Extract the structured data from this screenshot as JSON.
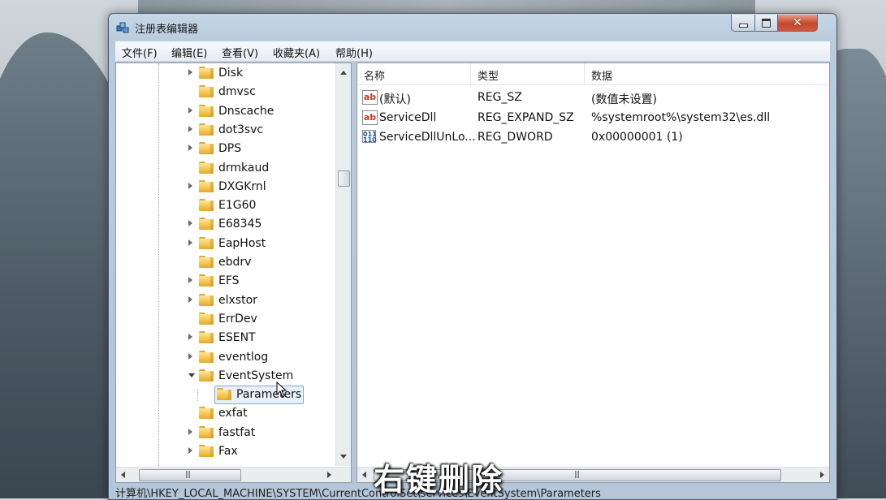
{
  "window": {
    "title": "注册表编辑器"
  },
  "menu": [
    "文件(F)",
    "编辑(E)",
    "查看(V)",
    "收藏夹(A)",
    "帮助(H)"
  ],
  "tree": {
    "items": [
      {
        "label": "Disk",
        "expandable": true
      },
      {
        "label": "dmvsc",
        "expandable": false
      },
      {
        "label": "Dnscache",
        "expandable": true
      },
      {
        "label": "dot3svc",
        "expandable": true
      },
      {
        "label": "DPS",
        "expandable": true
      },
      {
        "label": "drmkaud",
        "expandable": false
      },
      {
        "label": "DXGKrnl",
        "expandable": true
      },
      {
        "label": "E1G60",
        "expandable": false
      },
      {
        "label": "E68345",
        "expandable": true
      },
      {
        "label": "EapHost",
        "expandable": true
      },
      {
        "label": "ebdrv",
        "expandable": false
      },
      {
        "label": "EFS",
        "expandable": true
      },
      {
        "label": "elxstor",
        "expandable": true
      },
      {
        "label": "ErrDev",
        "expandable": false
      },
      {
        "label": "ESENT",
        "expandable": true
      },
      {
        "label": "eventlog",
        "expandable": true
      },
      {
        "label": "EventSystem",
        "expandable": true,
        "expanded": true
      },
      {
        "label": "Parameters",
        "expandable": false,
        "child": true,
        "selected": true
      },
      {
        "label": "exfat",
        "expandable": false
      },
      {
        "label": "fastfat",
        "expandable": true
      },
      {
        "label": "Fax",
        "expandable": true
      }
    ]
  },
  "list": {
    "columns": [
      "名称",
      "类型",
      "数据"
    ],
    "rows": [
      {
        "icon": "string-value-icon",
        "name": "(默认)",
        "type": "REG_SZ",
        "data": "(数值未设置)"
      },
      {
        "icon": "string-value-icon",
        "name": "ServiceDll",
        "type": "REG_EXPAND_SZ",
        "data": "%systemroot%\\system32\\es.dll"
      },
      {
        "icon": "binary-value-icon",
        "name": "ServiceDllUnLo...",
        "type": "REG_DWORD",
        "data": "0x00000001 (1)"
      }
    ]
  },
  "status": {
    "path": "计算机\\HKEY_LOCAL_MACHINE\\SYSTEM\\CurrentControlSet\\services\\EventSystem\\Parameters"
  },
  "caption": "右键删除",
  "icon_glyphs": {
    "string": "ab",
    "binary_top": "011",
    "binary_bottom": "110",
    "close": "✕",
    "grip": "|||"
  },
  "colors": {
    "selection": "#e8f1fb",
    "selection_border": "#7aa7d9",
    "close_button": "#c8462b"
  }
}
